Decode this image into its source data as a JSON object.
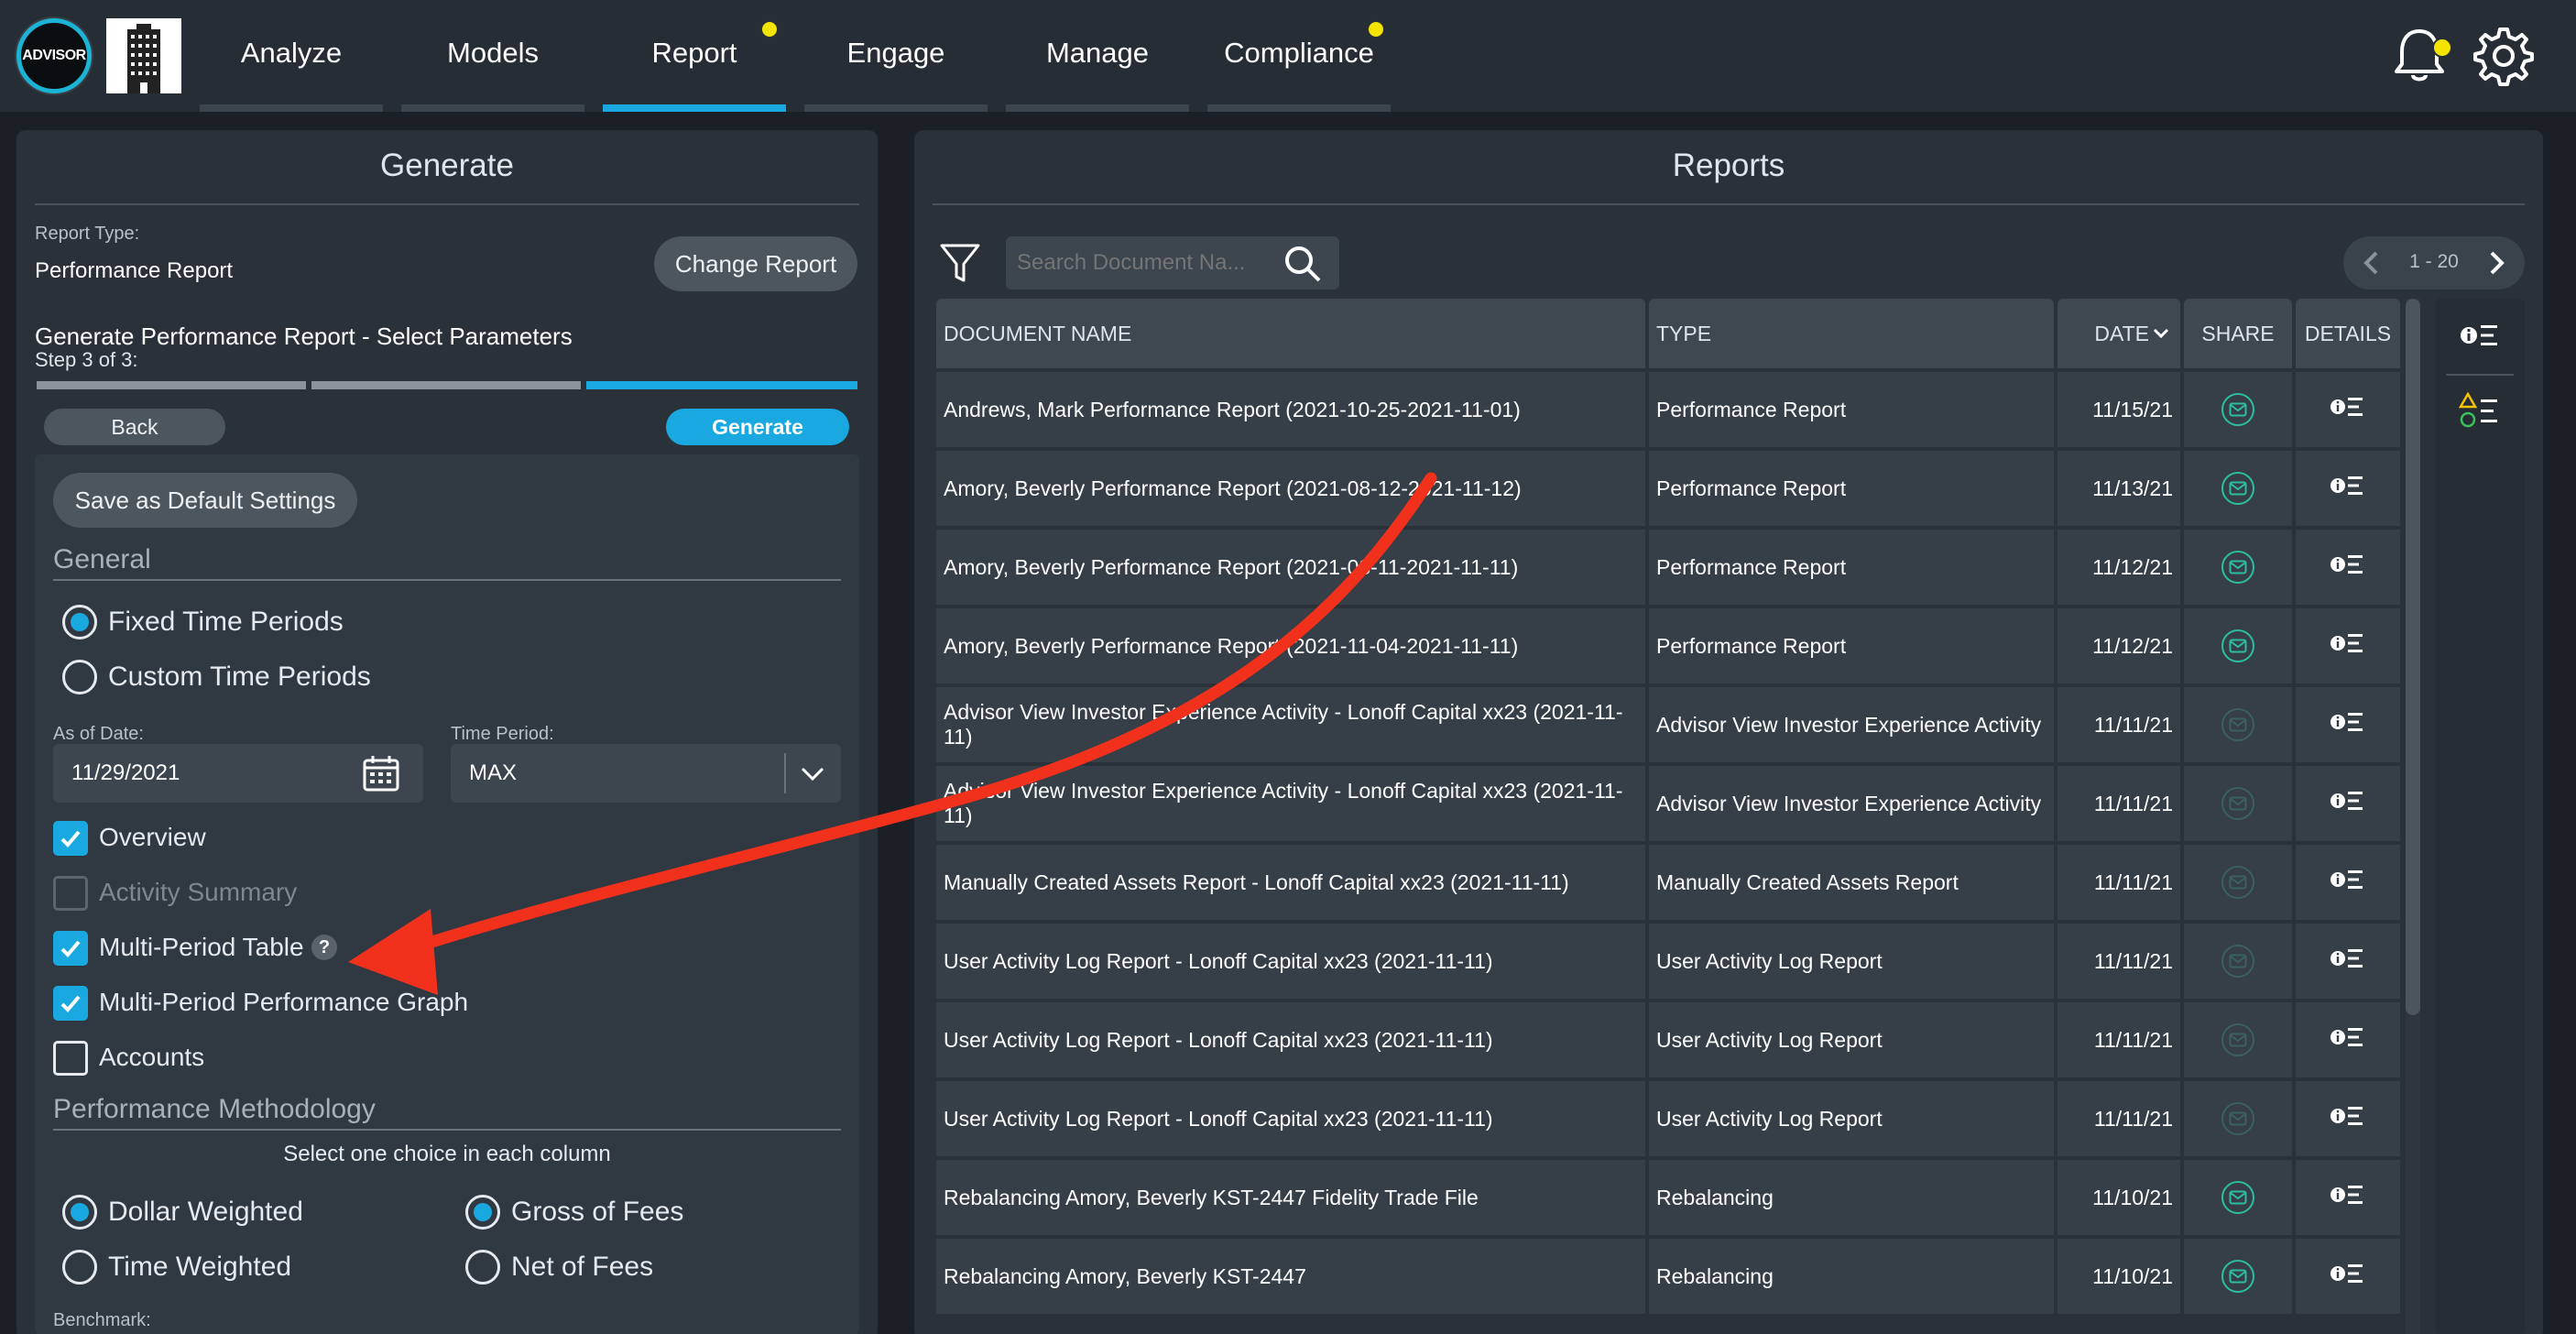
{
  "nav": {
    "logo_text": "ADVISOR",
    "tabs": [
      {
        "label": "Analyze",
        "active": false,
        "dot": false
      },
      {
        "label": "Models",
        "active": false,
        "dot": false
      },
      {
        "label": "Report",
        "active": true,
        "dot": true
      },
      {
        "label": "Engage",
        "active": false,
        "dot": false
      },
      {
        "label": "Manage",
        "active": false,
        "dot": false
      },
      {
        "label": "Compliance",
        "active": false,
        "dot": true
      }
    ],
    "icons": [
      "bell-icon",
      "gear-icon"
    ],
    "accent_color": "#1aa8e0",
    "notification_dot_color": "#f5e400"
  },
  "generate": {
    "title": "Generate",
    "report_type_label": "Report Type:",
    "report_type_value": "Performance Report",
    "change_report_label": "Change Report",
    "heading": "Generate Performance Report - Select Parameters",
    "step_text": "Step 3 of 3:",
    "steps_total": 3,
    "step_current": 3,
    "back_label": "Back",
    "generate_label": "Generate",
    "save_default_label": "Save as Default Settings",
    "general_label": "General",
    "time_periods": [
      {
        "label": "Fixed Time Periods",
        "selected": true
      },
      {
        "label": "Custom Time Periods",
        "selected": false
      }
    ],
    "as_of_date_label": "As of Date:",
    "as_of_date_value": "11/29/2021",
    "time_period_label": "Time Period:",
    "time_period_value": "MAX",
    "sections": [
      {
        "label": "Overview",
        "checked": true,
        "disabled": false
      },
      {
        "label": "Activity Summary",
        "checked": false,
        "disabled": true
      },
      {
        "label": "Multi-Period Table",
        "checked": true,
        "disabled": false,
        "help": "?"
      },
      {
        "label": "Multi-Period Performance Graph",
        "checked": true,
        "disabled": false
      },
      {
        "label": "Accounts",
        "checked": false,
        "disabled": false
      }
    ],
    "methodology_label": "Performance Methodology",
    "methodology_hint": "Select one choice in each column",
    "methodology_left": [
      {
        "label": "Dollar Weighted",
        "selected": true
      },
      {
        "label": "Time Weighted",
        "selected": false
      }
    ],
    "methodology_right": [
      {
        "label": "Gross of Fees",
        "selected": true
      },
      {
        "label": "Net of Fees",
        "selected": false
      }
    ],
    "benchmark_label": "Benchmark:"
  },
  "reports": {
    "title": "Reports",
    "search_placeholder": "Search Document Na...",
    "pager_text": "1 - 20",
    "columns": [
      "DOCUMENT NAME",
      "TYPE",
      "DATE",
      "SHARE",
      "DETAILS"
    ],
    "rows": [
      {
        "name": "Andrews, Mark Performance Report (2021-10-25-2021-11-01)",
        "type": "Performance Report",
        "date": "11/15/21",
        "share_active": true
      },
      {
        "name": "Amory, Beverly Performance Report (2021-08-12-2021-11-12)",
        "type": "Performance Report",
        "date": "11/13/21",
        "share_active": true
      },
      {
        "name": "Amory, Beverly Performance Report (2021-08-11-2021-11-11)",
        "type": "Performance Report",
        "date": "11/12/21",
        "share_active": true
      },
      {
        "name": "Amory, Beverly Performance Report (2021-11-04-2021-11-11)",
        "type": "Performance Report",
        "date": "11/12/21",
        "share_active": true
      },
      {
        "name": "Advisor View Investor Experience Activity - Lonoff Capital xx23 (2021-11-11)",
        "type": "Advisor View Investor Experience Activity",
        "date": "11/11/21",
        "share_active": false
      },
      {
        "name": "Advisor View Investor Experience Activity - Lonoff Capital xx23 (2021-11-11)",
        "type": "Advisor View Investor Experience Activity",
        "date": "11/11/21",
        "share_active": false
      },
      {
        "name": "Manually Created Assets Report - Lonoff Capital xx23 (2021-11-11)",
        "type": "Manually Created Assets Report",
        "date": "11/11/21",
        "share_active": false
      },
      {
        "name": "User Activity Log Report - Lonoff Capital xx23 (2021-11-11)",
        "type": "User Activity Log Report",
        "date": "11/11/21",
        "share_active": false
      },
      {
        "name": "User Activity Log Report - Lonoff Capital xx23 (2021-11-11)",
        "type": "User Activity Log Report",
        "date": "11/11/21",
        "share_active": false
      },
      {
        "name": "User Activity Log Report - Lonoff Capital xx23 (2021-11-11)",
        "type": "User Activity Log Report",
        "date": "11/11/21",
        "share_active": false
      },
      {
        "name": "Rebalancing Amory, Beverly KST-2447 Fidelity Trade File",
        "type": "Rebalancing",
        "date": "11/10/21",
        "share_active": true
      },
      {
        "name": "Rebalancing Amory, Beverly KST-2447",
        "type": "Rebalancing",
        "date": "11/10/21",
        "share_active": true
      }
    ]
  },
  "annotation": {
    "arrow_color": "#f2311c"
  }
}
